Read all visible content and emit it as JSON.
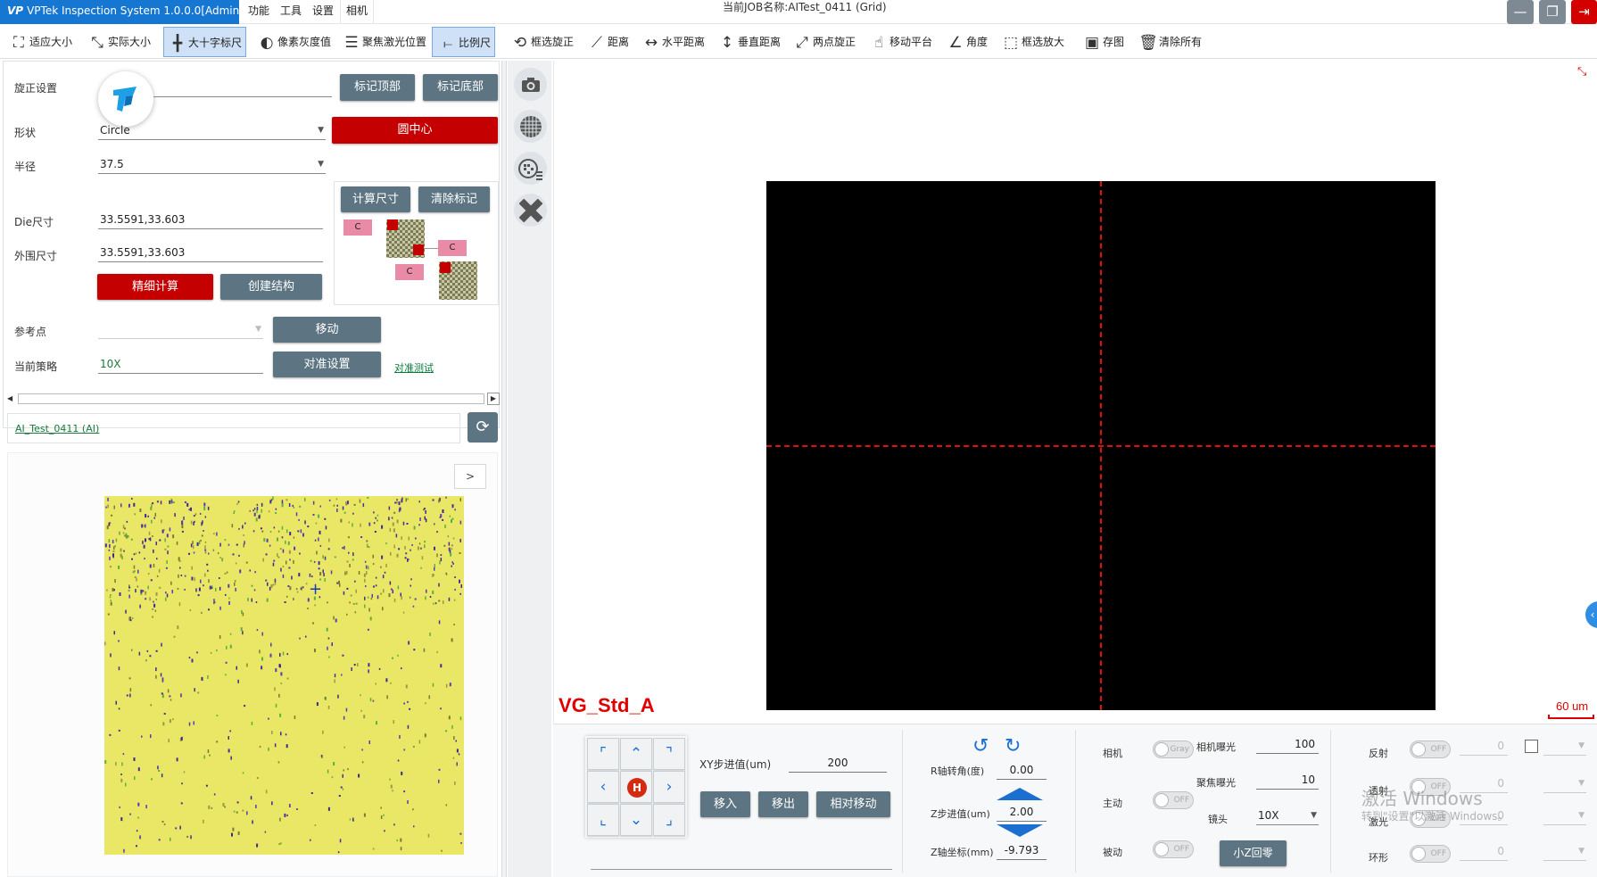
{
  "app": {
    "title": "VPTek Inspection System 1.0.0.0[Admin]",
    "logo": "VP"
  },
  "menu": {
    "items": [
      "功能",
      "工具",
      "设置",
      "相机"
    ]
  },
  "job": {
    "label": "当前JOB名称:",
    "name": "AITest_0411 (Grid)"
  },
  "window": {
    "minimize": "—",
    "restore": "❐",
    "close": "⇥"
  },
  "toolbar": {
    "items": [
      {
        "label": "适应大小",
        "icon": "fit-icon"
      },
      {
        "label": "实际大小",
        "icon": "actual-size-icon"
      },
      {
        "label": "大十字标尺",
        "icon": "crosshair-ruler-icon"
      },
      {
        "label": "像素灰度值",
        "icon": "pixel-gray-icon"
      },
      {
        "label": "聚焦激光位置",
        "icon": "focus-laser-icon"
      },
      {
        "label": "比例尺",
        "icon": "scale-ruler-icon"
      },
      {
        "label": "框选旋正",
        "icon": "box-rotate-icon"
      },
      {
        "label": "距离",
        "icon": "distance-icon"
      },
      {
        "label": "水平距离",
        "icon": "horizontal-distance-icon"
      },
      {
        "label": "垂直距离",
        "icon": "vertical-distance-icon"
      },
      {
        "label": "两点旋正",
        "icon": "two-point-rotate-icon"
      },
      {
        "label": "移动平台",
        "icon": "move-stage-icon"
      },
      {
        "label": "角度",
        "icon": "angle-icon"
      },
      {
        "label": "框选放大",
        "icon": "box-zoom-icon"
      },
      {
        "label": "存图",
        "icon": "save-image-icon"
      },
      {
        "label": "清除所有",
        "icon": "trash-icon"
      }
    ]
  },
  "align": {
    "rotate_label": "旋正设置",
    "mark_top": "标记顶部",
    "mark_bottom": "标记底部",
    "shape_label": "形状",
    "shape_value": "Circle",
    "circle_center": "圆中心",
    "radius_label": "半径",
    "radius_value": "37.5",
    "calc_size": "计算尺寸",
    "clear_mark": "清除标记",
    "die_label": "Die尺寸",
    "die_value": "33.5591,33.603",
    "outer_label": "外围尺寸",
    "outer_value": "33.5591,33.603",
    "fine_calc": "精细计算",
    "create_struct": "创建结构",
    "ref_label": "参考点",
    "ref_value": "",
    "move": "移动",
    "strategy_label": "当前策略",
    "strategy_value": "10X",
    "align_setup": "对准设置",
    "align_test": "对准测试",
    "c_marker": "C"
  },
  "recipe": {
    "name": "AI_Test_0411 (AI)"
  },
  "map": {
    "expand": ">"
  },
  "camera": {
    "overlay_label": "VG_Std_A",
    "scale_label": "60 um",
    "side_icons": [
      "camera-icon",
      "grid-icon",
      "wafer-map-icon",
      "ruler-tools-icon"
    ]
  },
  "motion": {
    "xy_step_label": "XY步进值(um)",
    "xy_step_value": "200",
    "move_in": "移入",
    "move_out": "移出",
    "relative_move": "相对移动",
    "home": "H"
  },
  "axis": {
    "r_label": "R轴转角(度)",
    "r_value": "0.00",
    "z_step_label": "Z步进值(um)",
    "z_step_value": "2.00",
    "z_pos_label": "Z轴坐标(mm)",
    "z_pos_value": "-9.793"
  },
  "cam": {
    "camera_label": "相机",
    "camera_toggle": "Gray",
    "exposure_label": "相机曝光",
    "exposure_value": "100",
    "focus_exposure_label": "聚焦曝光",
    "focus_exposure_value": "10",
    "active_label": "主动",
    "active_toggle": "OFF",
    "lens_label": "镜头",
    "lens_value": "10X",
    "passive_label": "被动",
    "passive_toggle": "OFF",
    "z_home": "小Z回零"
  },
  "light": {
    "reflect_label": "反射",
    "trans_label": "透射",
    "laser_label": "激光",
    "ring_label": "环形",
    "toggle": "OFF",
    "value": "0"
  },
  "watermark": {
    "line1": "激活 Windows",
    "line2": "转到\"设置\"以激活 Windows。"
  }
}
